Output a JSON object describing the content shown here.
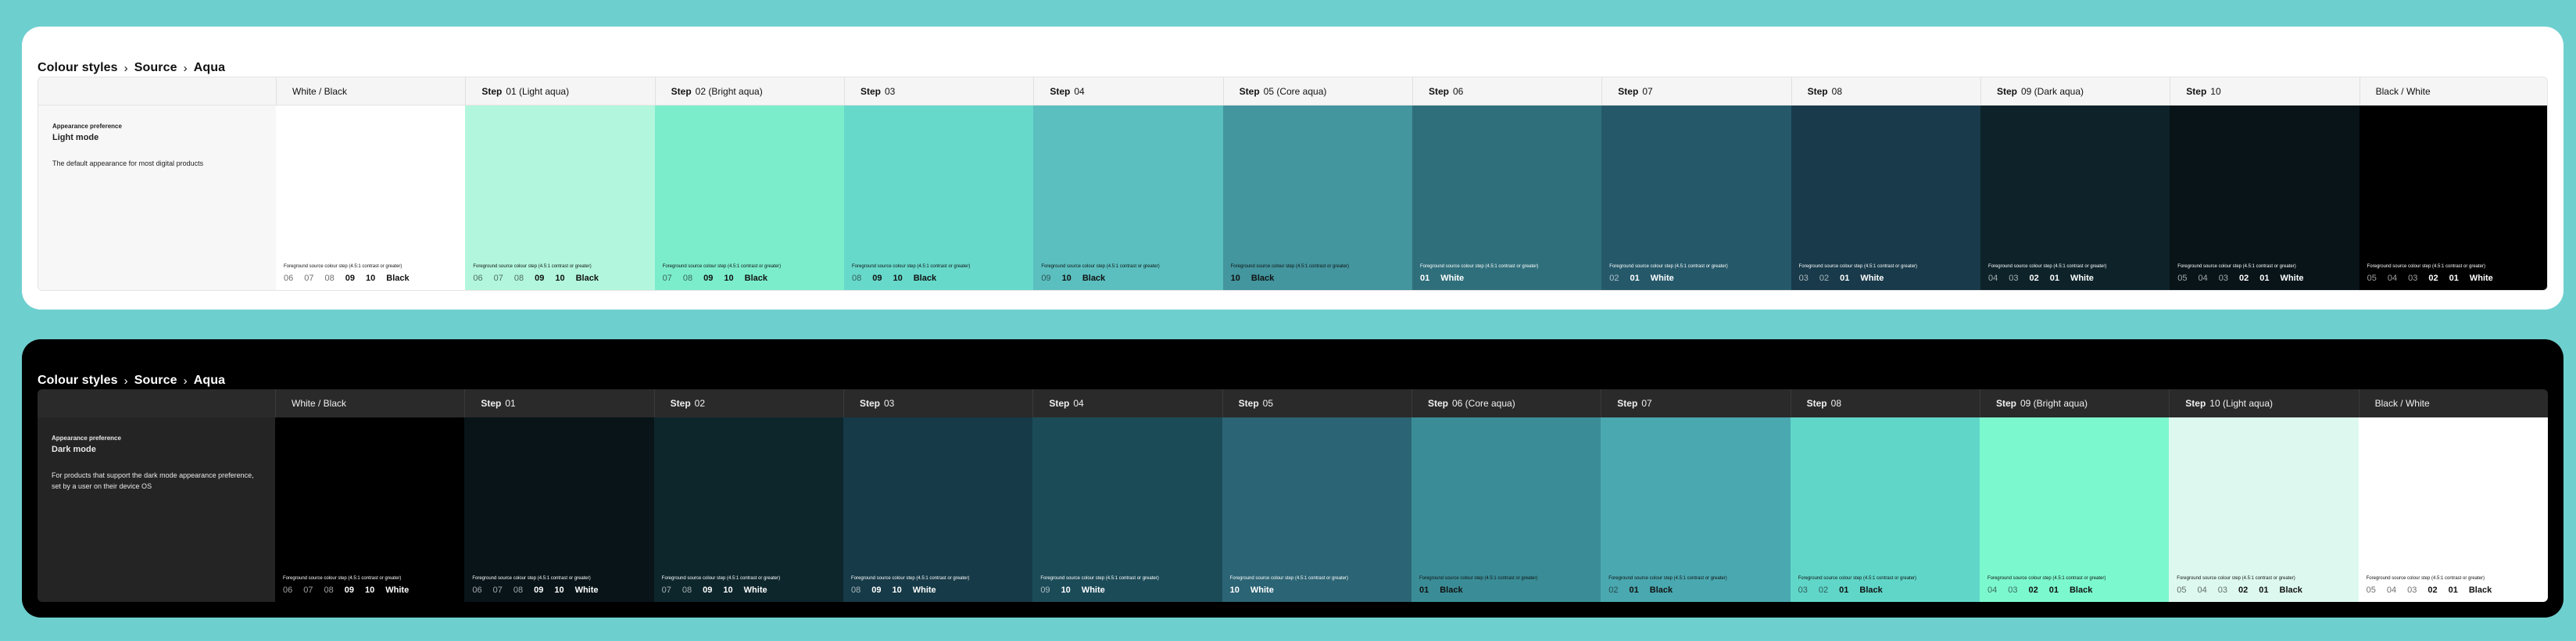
{
  "panels": [
    {
      "theme": "light",
      "breadcrumb": [
        "Colour styles",
        "Source",
        "Aqua"
      ],
      "row_header": {
        "pref_label": "Appearance preference",
        "mode": "Light mode",
        "note": "The default appearance for most digital products"
      },
      "columns": [
        {
          "bold": "",
          "label": "White / Black",
          "bg": "#ffffff",
          "fg": "#111111",
          "fg_note": "Foreground source colour step (4.5:1 contrast or greater)",
          "steps": [
            "06",
            "07",
            "08",
            "09",
            "10",
            "Black"
          ],
          "strong_from": 3
        },
        {
          "bold": "Step",
          "label": "01 (Light aqua)",
          "bg": "#b2f7dd",
          "fg": "#111111",
          "fg_note": "Foreground source colour step (4.5:1 contrast or greater)",
          "steps": [
            "06",
            "07",
            "08",
            "09",
            "10",
            "Black"
          ],
          "strong_from": 3
        },
        {
          "bold": "Step",
          "label": "02 (Bright aqua)",
          "bg": "#7bedcb",
          "fg": "#111111",
          "fg_note": "Foreground source colour step (4.5:1 contrast or greater)",
          "steps": [
            "07",
            "08",
            "09",
            "10",
            "Black"
          ],
          "strong_from": 2
        },
        {
          "bold": "Step",
          "label": "03",
          "bg": "#67d9cb",
          "fg": "#111111",
          "fg_note": "Foreground source colour step (4.5:1 contrast or greater)",
          "steps": [
            "08",
            "09",
            "10",
            "Black"
          ],
          "strong_from": 1
        },
        {
          "bold": "Step",
          "label": "04",
          "bg": "#5bbfbf",
          "fg": "#111111",
          "fg_note": "Foreground source colour step (4.5:1 contrast or greater)",
          "steps": [
            "09",
            "10",
            "Black"
          ],
          "strong_from": 1
        },
        {
          "bold": "Step",
          "label": "05 (Core aqua)",
          "bg": "#43959e",
          "fg": "#111111",
          "fg_note": "Foreground source colour step (4.5:1 contrast or greater)",
          "steps": [
            "10",
            "Black"
          ],
          "strong_from": 0
        },
        {
          "bold": "Step",
          "label": "06",
          "bg": "#2f6f7b",
          "fg": "#ffffff",
          "fg_note": "Foreground source colour step (4.5:1 contrast or greater)",
          "steps": [
            "01",
            "White"
          ],
          "strong_from": 0
        },
        {
          "bold": "Step",
          "label": "07",
          "bg": "#25596a",
          "fg": "#ffffff",
          "fg_note": "Foreground source colour step (4.5:1 contrast or greater)",
          "steps": [
            "02",
            "01",
            "White"
          ],
          "strong_from": 1
        },
        {
          "bold": "Step",
          "label": "08",
          "bg": "#183a4a",
          "fg": "#ffffff",
          "fg_note": "Foreground source colour step (4.5:1 contrast or greater)",
          "steps": [
            "03",
            "02",
            "01",
            "White"
          ],
          "strong_from": 2
        },
        {
          "bold": "Step",
          "label": "09 (Dark aqua)",
          "bg": "#0d2329",
          "fg": "#ffffff",
          "fg_note": "Foreground source colour step (4.5:1 contrast or greater)",
          "steps": [
            "04",
            "03",
            "02",
            "01",
            "White"
          ],
          "strong_from": 2
        },
        {
          "bold": "Step",
          "label": "10",
          "bg": "#081418",
          "fg": "#ffffff",
          "fg_note": "Foreground source colour step (4.5:1 contrast or greater)",
          "steps": [
            "05",
            "04",
            "03",
            "02",
            "01",
            "White"
          ],
          "strong_from": 3
        },
        {
          "bold": "",
          "label": "Black / White",
          "bg": "#000000",
          "fg": "#ffffff",
          "fg_note": "Foreground source colour step (4.5:1 contrast or greater)",
          "steps": [
            "05",
            "04",
            "03",
            "02",
            "01",
            "White"
          ],
          "strong_from": 3
        }
      ]
    },
    {
      "theme": "dark",
      "breadcrumb": [
        "Colour styles",
        "Source",
        "Aqua"
      ],
      "row_header": {
        "pref_label": "Appearance preference",
        "mode": "Dark mode",
        "note": "For products that support the dark mode appearance preference, set by a user on their device OS"
      },
      "columns": [
        {
          "bold": "",
          "label": "White / Black",
          "bg": "#000000",
          "fg": "#ffffff",
          "fg_note": "Foreground source colour step (4.5:1 contrast or greater)",
          "steps": [
            "06",
            "07",
            "08",
            "09",
            "10",
            "White"
          ],
          "strong_from": 3
        },
        {
          "bold": "Step",
          "label": "01",
          "bg": "#081418",
          "fg": "#ffffff",
          "fg_note": "Foreground source colour step (4.5:1 contrast or greater)",
          "steps": [
            "06",
            "07",
            "08",
            "09",
            "10",
            "White"
          ],
          "strong_from": 3
        },
        {
          "bold": "Step",
          "label": "02",
          "bg": "#0d262c",
          "fg": "#ffffff",
          "fg_note": "Foreground source colour step (4.5:1 contrast or greater)",
          "steps": [
            "07",
            "08",
            "09",
            "10",
            "White"
          ],
          "strong_from": 2
        },
        {
          "bold": "Step",
          "label": "03",
          "bg": "#163a47",
          "fg": "#ffffff",
          "fg_note": "Foreground source colour step (4.5:1 contrast or greater)",
          "steps": [
            "08",
            "09",
            "10",
            "White"
          ],
          "strong_from": 1
        },
        {
          "bold": "Step",
          "label": "04",
          "bg": "#1c4b58",
          "fg": "#ffffff",
          "fg_note": "Foreground source colour step (4.5:1 contrast or greater)",
          "steps": [
            "09",
            "10",
            "White"
          ],
          "strong_from": 1
        },
        {
          "bold": "Step",
          "label": "05",
          "bg": "#2b6474",
          "fg": "#ffffff",
          "fg_note": "Foreground source colour step (4.5:1 contrast or greater)",
          "steps": [
            "10",
            "White"
          ],
          "strong_from": 0
        },
        {
          "bold": "Step",
          "label": "06 (Core aqua)",
          "bg": "#3a8d97",
          "fg": "#111111",
          "fg_note": "Foreground source colour step (4.5:1 contrast or greater)",
          "steps": [
            "01",
            "Black"
          ],
          "strong_from": 0
        },
        {
          "bold": "Step",
          "label": "07",
          "bg": "#4aa8b0",
          "fg": "#111111",
          "fg_note": "Foreground source colour step (4.5:1 contrast or greater)",
          "steps": [
            "02",
            "01",
            "Black"
          ],
          "strong_from": 1
        },
        {
          "bold": "Step",
          "label": "08",
          "bg": "#60d6c9",
          "fg": "#111111",
          "fg_note": "Foreground source colour step (4.5:1 contrast or greater)",
          "steps": [
            "03",
            "02",
            "01",
            "Black"
          ],
          "strong_from": 2
        },
        {
          "bold": "Step",
          "label": "09 (Bright aqua)",
          "bg": "#7cf8cf",
          "fg": "#111111",
          "fg_note": "Foreground source colour step (4.5:1 contrast or greater)",
          "steps": [
            "04",
            "03",
            "02",
            "01",
            "Black"
          ],
          "strong_from": 2
        },
        {
          "bold": "Step",
          "label": "10 (Light aqua)",
          "bg": "#ddf9ef",
          "fg": "#111111",
          "fg_note": "Foreground source colour step (4.5:1 contrast or greater)",
          "steps": [
            "05",
            "04",
            "03",
            "02",
            "01",
            "Black"
          ],
          "strong_from": 3
        },
        {
          "bold": "",
          "label": "Black / White",
          "bg": "#ffffff",
          "fg": "#111111",
          "fg_note": "Foreground source colour step (4.5:1 contrast or greater)",
          "steps": [
            "05",
            "04",
            "03",
            "02",
            "01",
            "Black"
          ],
          "strong_from": 3
        }
      ]
    }
  ]
}
